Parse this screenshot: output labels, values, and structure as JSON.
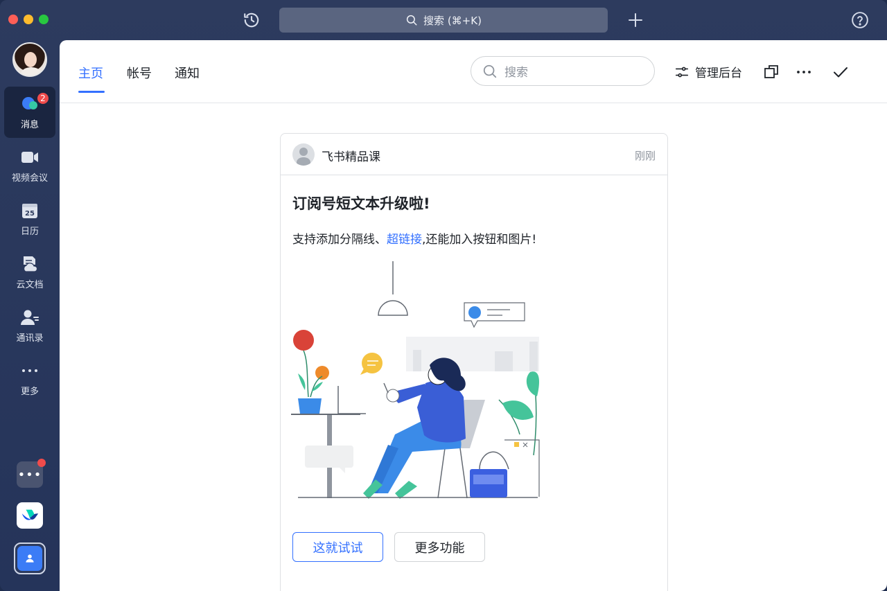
{
  "titlebar": {
    "search_placeholder": "搜索 (⌘+K)"
  },
  "sidebar": {
    "items": [
      {
        "label": "消息",
        "icon": "chat-bubble-icon",
        "badge": "2",
        "active": true
      },
      {
        "label": "视频会议",
        "icon": "video-camera-icon"
      },
      {
        "label": "日历",
        "icon": "calendar-icon",
        "icon_text": "25"
      },
      {
        "label": "云文档",
        "icon": "cloud-doc-icon"
      },
      {
        "label": "通讯录",
        "icon": "contacts-icon"
      },
      {
        "label": "更多",
        "icon": "more-dots-icon"
      }
    ]
  },
  "header": {
    "tabs": [
      {
        "label": "主页",
        "active": true
      },
      {
        "label": "帐号"
      },
      {
        "label": "通知"
      }
    ],
    "search_placeholder": "搜索",
    "admin_label": "管理后台"
  },
  "card": {
    "sender": "飞书精品课",
    "time": "刚刚",
    "title": "订阅号短文本升级啦!",
    "text_before": "支持添加分隔线、",
    "link_text": "超链接",
    "text_after": ",还能加入按钮和图片!",
    "primary_button": "这就试试",
    "secondary_button": "更多功能"
  },
  "colors": {
    "accent": "#3370ff",
    "sidebar_bg": "#2d3b5e",
    "badge": "#f04b4b"
  }
}
